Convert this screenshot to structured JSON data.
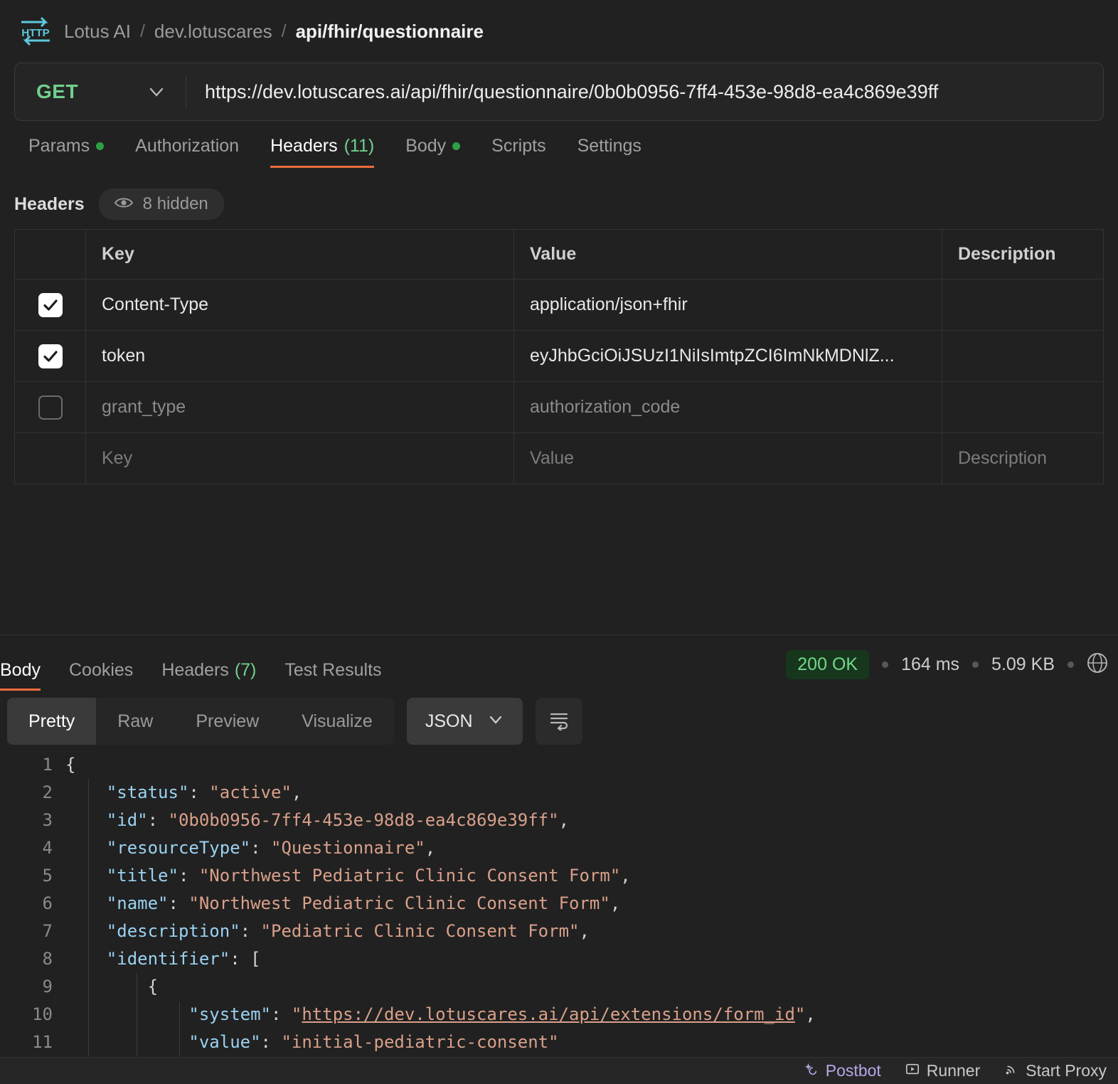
{
  "breadcrumb": {
    "icon": "http-protocol-icon",
    "workspace": "Lotus AI",
    "sep": "/",
    "collection": "dev.lotuscares",
    "request": "api/fhir/questionnaire"
  },
  "url_bar": {
    "method": "GET",
    "method_caret": "chevron-down-icon",
    "url": "https://dev.lotuscares.ai/api/fhir/questionnaire/0b0b0956-7ff4-453e-98d8-ea4c869e39ff"
  },
  "request_tabs": [
    {
      "label": "Params",
      "dot": true,
      "count": "",
      "active": false
    },
    {
      "label": "Authorization",
      "dot": false,
      "count": "",
      "active": false
    },
    {
      "label": "Headers",
      "dot": false,
      "count": "(11)",
      "active": true
    },
    {
      "label": "Body",
      "dot": true,
      "count": "",
      "active": false
    },
    {
      "label": "Scripts",
      "dot": false,
      "count": "",
      "active": false
    },
    {
      "label": "Settings",
      "dot": false,
      "count": "",
      "active": false
    }
  ],
  "headers_section": {
    "title": "Headers",
    "hidden_pill": "8 hidden",
    "eye_icon": "eye-icon",
    "columns": [
      "Key",
      "Value",
      "Description"
    ],
    "rows": [
      {
        "checked": true,
        "enabled": true,
        "key": "Content-Type",
        "value": "application/json+fhir",
        "description": ""
      },
      {
        "checked": true,
        "enabled": true,
        "key": "token",
        "value": "eyJhbGciOiJSUzI1NiIsImtpZCI6ImNkMDNlZ...",
        "description": ""
      },
      {
        "checked": false,
        "enabled": false,
        "key": "grant_type",
        "value": "authorization_code",
        "description": ""
      }
    ],
    "empty_row": {
      "key": "Key",
      "value": "Value",
      "description": "Description"
    }
  },
  "response_tabs": [
    {
      "label": "Body",
      "count": "",
      "active": true
    },
    {
      "label": "Cookies",
      "count": "",
      "active": false
    },
    {
      "label": "Headers",
      "count": "(7)",
      "active": false
    },
    {
      "label": "Test Results",
      "count": "",
      "active": false
    }
  ],
  "response_meta": {
    "status": "200 OK",
    "time": "164 ms",
    "size": "5.09 KB",
    "trailing_icon": "globe-icon"
  },
  "format_toolbar": {
    "segments": [
      {
        "label": "Pretty",
        "active": true
      },
      {
        "label": "Raw",
        "active": false
      },
      {
        "label": "Preview",
        "active": false
      },
      {
        "label": "Visualize",
        "active": false
      }
    ],
    "language": "JSON",
    "language_caret": "chevron-down-icon",
    "wrap_button": "wrap-lines-icon"
  },
  "code": {
    "language": "json",
    "lines": [
      {
        "num": "1",
        "indent": 0,
        "tokens": [
          {
            "t": "p",
            "v": "{"
          }
        ]
      },
      {
        "num": "2",
        "indent": 1,
        "tokens": [
          {
            "t": "k",
            "v": "\"status\""
          },
          {
            "t": "p",
            "v": ": "
          },
          {
            "t": "s",
            "v": "\"active\""
          },
          {
            "t": "p",
            "v": ","
          }
        ]
      },
      {
        "num": "3",
        "indent": 1,
        "tokens": [
          {
            "t": "k",
            "v": "\"id\""
          },
          {
            "t": "p",
            "v": ": "
          },
          {
            "t": "s",
            "v": "\"0b0b0956-7ff4-453e-98d8-ea4c869e39ff\""
          },
          {
            "t": "p",
            "v": ","
          }
        ]
      },
      {
        "num": "4",
        "indent": 1,
        "tokens": [
          {
            "t": "k",
            "v": "\"resourceType\""
          },
          {
            "t": "p",
            "v": ": "
          },
          {
            "t": "s",
            "v": "\"Questionnaire\""
          },
          {
            "t": "p",
            "v": ","
          }
        ]
      },
      {
        "num": "5",
        "indent": 1,
        "tokens": [
          {
            "t": "k",
            "v": "\"title\""
          },
          {
            "t": "p",
            "v": ": "
          },
          {
            "t": "s",
            "v": "\"Northwest Pediatric Clinic Consent Form\""
          },
          {
            "t": "p",
            "v": ","
          }
        ]
      },
      {
        "num": "6",
        "indent": 1,
        "tokens": [
          {
            "t": "k",
            "v": "\"name\""
          },
          {
            "t": "p",
            "v": ": "
          },
          {
            "t": "s",
            "v": "\"Northwest Pediatric Clinic Consent Form\""
          },
          {
            "t": "p",
            "v": ","
          }
        ]
      },
      {
        "num": "7",
        "indent": 1,
        "tokens": [
          {
            "t": "k",
            "v": "\"description\""
          },
          {
            "t": "p",
            "v": ": "
          },
          {
            "t": "s",
            "v": "\"Pediatric Clinic Consent Form\""
          },
          {
            "t": "p",
            "v": ","
          }
        ]
      },
      {
        "num": "8",
        "indent": 1,
        "tokens": [
          {
            "t": "k",
            "v": "\"identifier\""
          },
          {
            "t": "p",
            "v": ": ["
          }
        ]
      },
      {
        "num": "9",
        "indent": 2,
        "tokens": [
          {
            "t": "p",
            "v": "{"
          }
        ]
      },
      {
        "num": "10",
        "indent": 3,
        "tokens": [
          {
            "t": "k",
            "v": "\"system\""
          },
          {
            "t": "p",
            "v": ": "
          },
          {
            "t": "s",
            "v": "\""
          },
          {
            "t": "lnk",
            "v": "https://dev.lotuscares.ai/api/extensions/form_id"
          },
          {
            "t": "s",
            "v": "\""
          },
          {
            "t": "p",
            "v": ","
          }
        ]
      },
      {
        "num": "11",
        "indent": 3,
        "tokens": [
          {
            "t": "k",
            "v": "\"value\""
          },
          {
            "t": "p",
            "v": ": "
          },
          {
            "t": "s",
            "v": "\"initial-pediatric-consent\""
          }
        ]
      }
    ]
  },
  "bottom_bar": [
    {
      "label": "Postbot",
      "icon": "sparkle-icon",
      "style": "accent"
    },
    {
      "label": "Runner",
      "icon": "play-box-icon",
      "style": "plain"
    },
    {
      "label": "Start Proxy",
      "icon": "broadcast-icon",
      "style": "plain"
    }
  ]
}
